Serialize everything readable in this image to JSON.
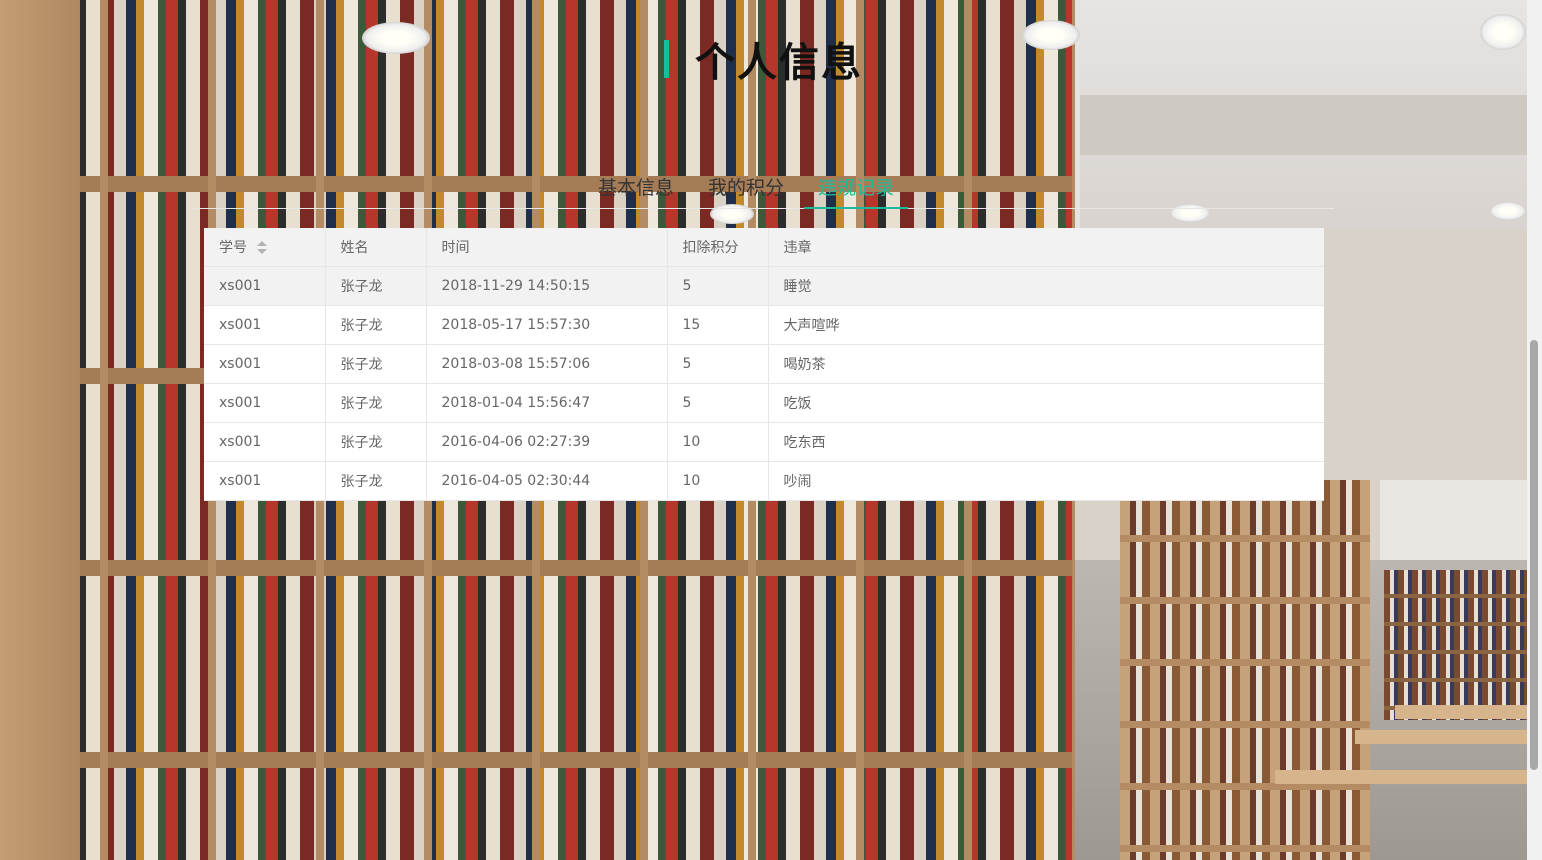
{
  "page": {
    "title": "个人信息",
    "accent": "#1bbc9b"
  },
  "tabs": [
    {
      "label": "基本信息",
      "active": false
    },
    {
      "label": "我的积分",
      "active": false
    },
    {
      "label": "违规记录",
      "active": true
    }
  ],
  "table": {
    "headers": [
      "学号",
      "姓名",
      "时间",
      "扣除积分",
      "违章"
    ],
    "rows": [
      [
        "xs001",
        "张子龙",
        "2018-11-29 14:50:15",
        "5",
        "睡觉"
      ],
      [
        "xs001",
        "张子龙",
        "2018-05-17 15:57:30",
        "15",
        "大声喧哗"
      ],
      [
        "xs001",
        "张子龙",
        "2018-03-08 15:57:06",
        "5",
        "喝奶茶"
      ],
      [
        "xs001",
        "张子龙",
        "2018-01-04 15:56:47",
        "5",
        "吃饭"
      ],
      [
        "xs001",
        "张子龙",
        "2016-04-06 02:27:39",
        "10",
        "吃东西"
      ],
      [
        "xs001",
        "张子龙",
        "2016-04-05 02:30:44",
        "10",
        "吵闹"
      ]
    ]
  }
}
